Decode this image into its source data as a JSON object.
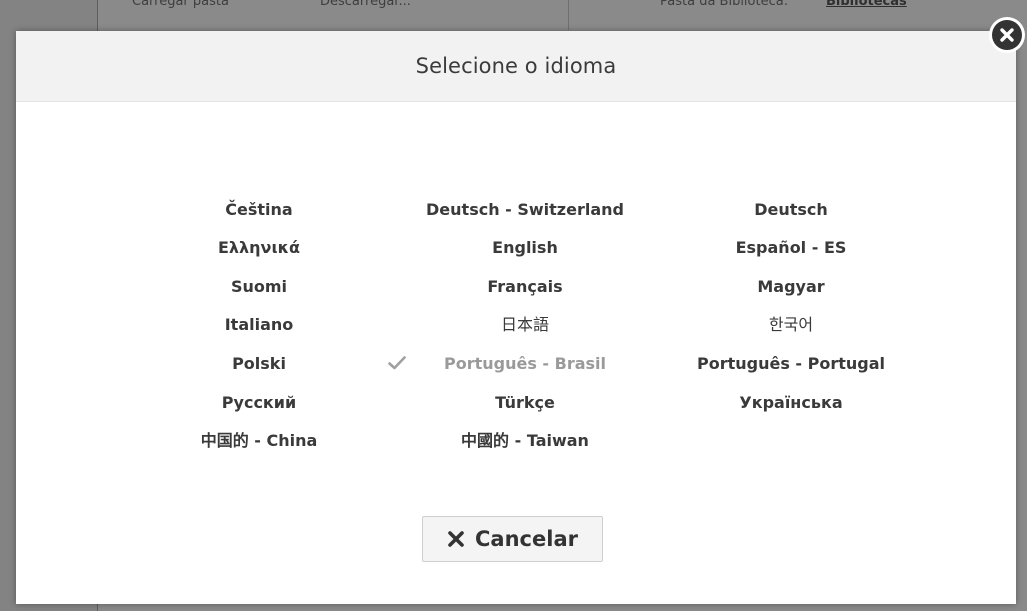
{
  "background": {
    "left_text": "Carregar pasta",
    "middle_text": "Descarregar...",
    "library_label": "Pasta da Biblioteca:",
    "library_value": "Bibliotecas"
  },
  "modal": {
    "title": "Selecione o idioma",
    "languages": [
      "Čeština",
      "Deutsch - Switzerland",
      "Deutsch",
      "Ελληνικά",
      "English",
      "Español - ES",
      "Suomi",
      "Français",
      "Magyar",
      "Italiano",
      "日本語",
      "한국어",
      "Polski",
      "Português - Brasil",
      "Português - Portugal",
      "Русский",
      "Türkçe",
      "Українська",
      "中国的 - China",
      "中國的 - Taiwan"
    ],
    "selected_language": "Português - Brasil",
    "cancel_label": "Cancelar"
  },
  "icons": {
    "close": "close-circle-icon",
    "check": "check-icon",
    "cancel": "x-icon"
  }
}
